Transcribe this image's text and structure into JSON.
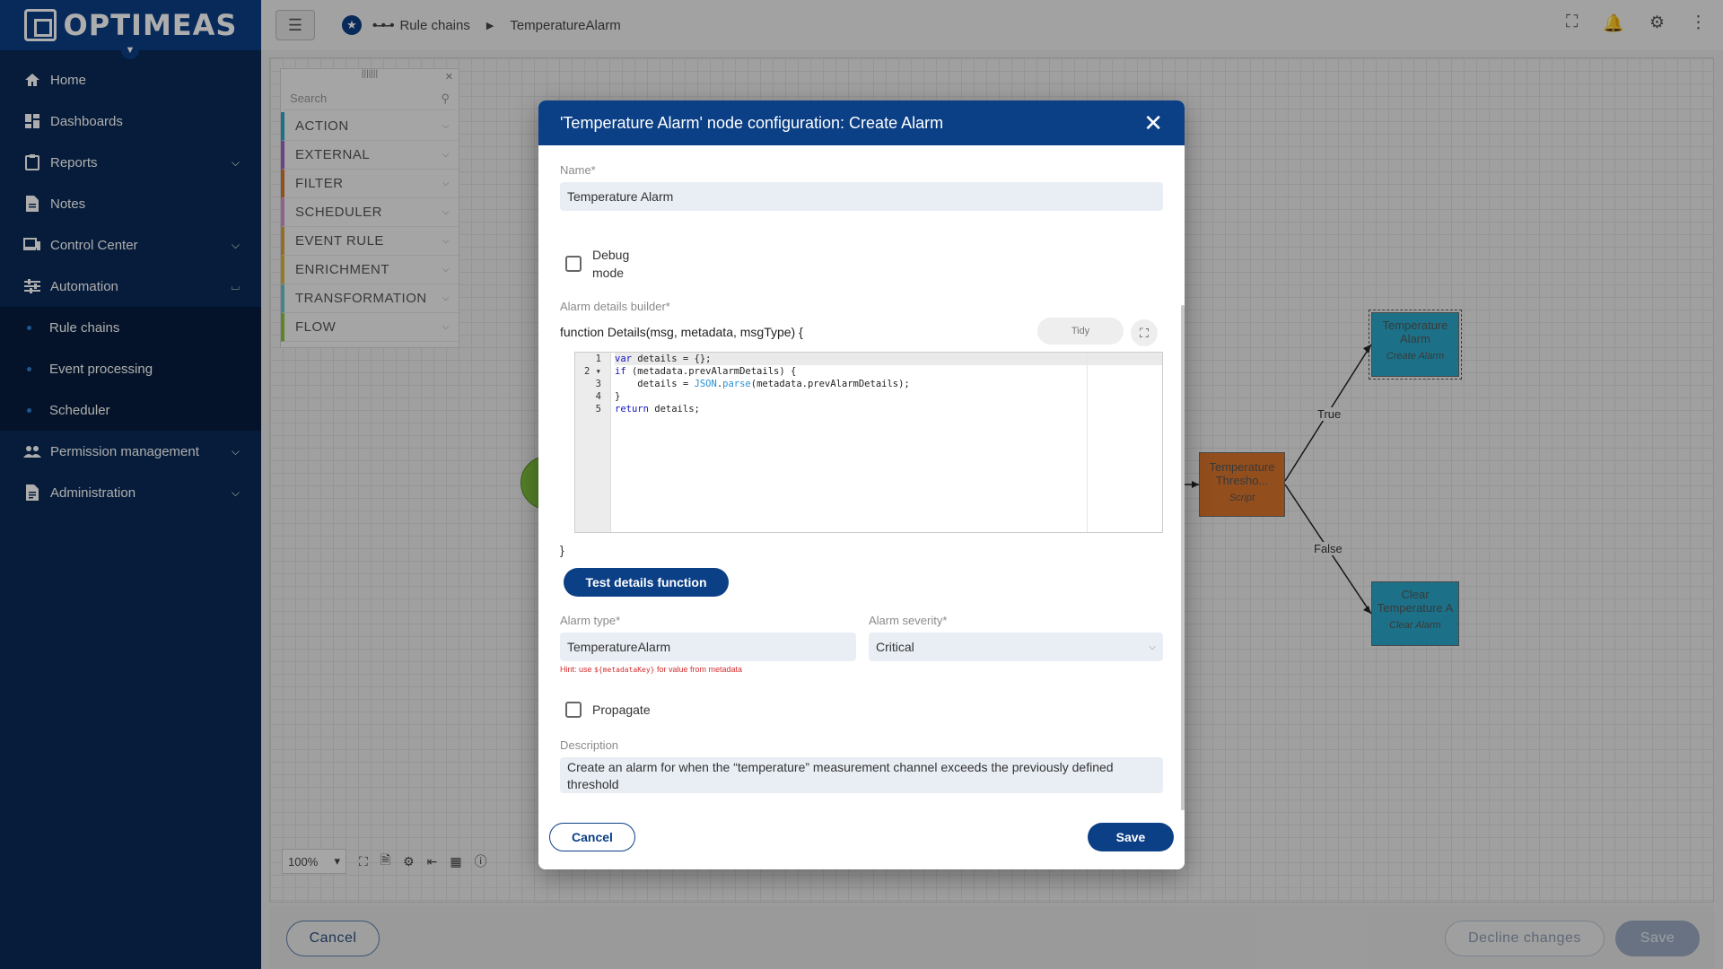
{
  "app": {
    "logo_text": "OPTIMEAS"
  },
  "sidebar": {
    "items": [
      {
        "label": "Home",
        "icon": "home-icon"
      },
      {
        "label": "Dashboards",
        "icon": "dashboard-icon"
      },
      {
        "label": "Reports",
        "icon": "clipboard-icon"
      },
      {
        "label": "Notes",
        "icon": "note-icon"
      },
      {
        "label": "Control Center",
        "icon": "devices-icon"
      },
      {
        "label": "Automation",
        "icon": "tune-icon"
      },
      {
        "label": "Permission management",
        "icon": "people-icon"
      },
      {
        "label": "Administration",
        "icon": "document-icon"
      }
    ],
    "automation_children": [
      "Rule chains",
      "Event processing",
      "Scheduler"
    ]
  },
  "breadcrumb": {
    "item1": "Rule chains",
    "item2": "TemperatureAlarm"
  },
  "library": {
    "search_placeholder": "Search",
    "categories": [
      {
        "label": "ACTION",
        "color": "#2aa7c9"
      },
      {
        "label": "EXTERNAL",
        "color": "#9c62c9"
      },
      {
        "label": "FILTER",
        "color": "#d9742c"
      },
      {
        "label": "SCHEDULER",
        "color": "#d38fd0"
      },
      {
        "label": "EVENT RULE",
        "color": "#d8a33b"
      },
      {
        "label": "ENRICHMENT",
        "color": "#d8b43b"
      },
      {
        "label": "TRANSFORMATION",
        "color": "#63c4cc"
      },
      {
        "label": "FLOW",
        "color": "#8cc43d"
      }
    ]
  },
  "canvas": {
    "nodes": {
      "temperature_alarm": {
        "title": "Temperature Alarm",
        "type": "Create Alarm"
      },
      "threshold": {
        "title": "Temperature Thresho...",
        "type": "Script"
      },
      "clear_alarm": {
        "title": "Clear Temperature A",
        "type": "Clear Alarm"
      }
    },
    "edges": {
      "true_label": "True",
      "false_label": "False"
    },
    "zoom": "100%"
  },
  "bottombar": {
    "cancel": "Cancel",
    "decline": "Decline changes",
    "save": "Save"
  },
  "modal": {
    "title": "'Temperature Alarm' node configuration: Create Alarm",
    "name_label": "Name*",
    "name_value": "Temperature Alarm",
    "debug_label_1": "Debug",
    "debug_label_2": "mode",
    "builder_label": "Alarm details builder*",
    "function_signature": "function Details(msg, metadata, msgType) {",
    "function_close": "}",
    "tidy_label": "Tidy",
    "test_button": "Test details function",
    "alarm_type_label": "Alarm type*",
    "alarm_type_value": "TemperatureAlarm",
    "hint_prefix": "Hint: use",
    "hint_code": "${metadataKey}",
    "hint_suffix": "for value from metadata",
    "severity_label": "Alarm severity*",
    "severity_value": "Critical",
    "propagate_label": "Propagate",
    "description_label": "Description",
    "description_value": "Create an alarm for when the “temperature” measurement channel exceeds the previously defined threshold",
    "cancel": "Cancel",
    "save": "Save"
  },
  "code": {
    "line_numbers": [
      "1",
      "2",
      "3",
      "4",
      "5"
    ]
  }
}
